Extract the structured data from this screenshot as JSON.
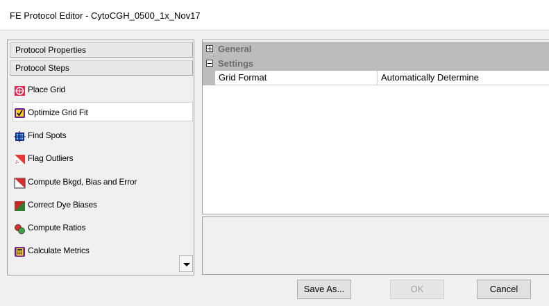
{
  "window": {
    "title": "FE Protocol Editor - CytoCGH_0500_1x_Nov17"
  },
  "left_pane": {
    "protocol_properties_label": "Protocol Properties",
    "protocol_steps_label": "Protocol Steps",
    "steps": [
      {
        "label": "Place Grid",
        "icon": "place-grid-icon"
      },
      {
        "label": "Optimize Grid Fit",
        "icon": "optimize-grid-fit-icon",
        "selected": true
      },
      {
        "label": "Find Spots",
        "icon": "find-spots-icon"
      },
      {
        "label": "Flag Outliers",
        "icon": "flag-outliers-icon"
      },
      {
        "label": "Compute Bkgd, Bias and Error",
        "icon": "compute-bkgd-icon"
      },
      {
        "label": "Correct Dye Biases",
        "icon": "correct-dye-biases-icon"
      },
      {
        "label": "Compute Ratios",
        "icon": "compute-ratios-icon"
      },
      {
        "label": "Calculate Metrics",
        "icon": "calculate-metrics-icon"
      }
    ]
  },
  "property_grid": {
    "categories": [
      {
        "label": "General",
        "expanded": false
      },
      {
        "label": "Settings",
        "expanded": true
      }
    ],
    "properties": [
      {
        "name": "Grid Format",
        "value": "Automatically Determine"
      }
    ]
  },
  "buttons": {
    "save_as": "Save As...",
    "ok": "OK",
    "cancel": "Cancel"
  },
  "colors": {
    "category_bg": "#bcbcbc",
    "category_text": "#6d6d6d",
    "window_bg": "#f0f0f0"
  }
}
